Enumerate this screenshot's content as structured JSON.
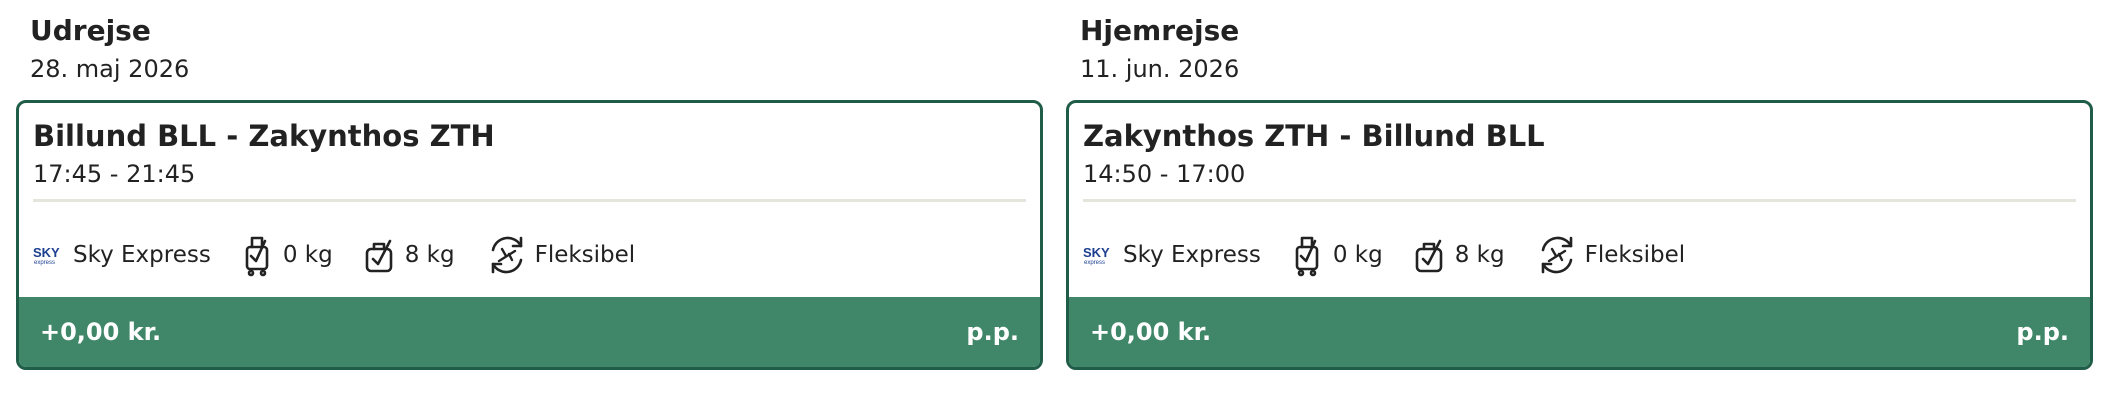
{
  "legs": [
    {
      "title": "Udrejse",
      "date": "28. maj 2026",
      "route": "Billund BLL - Zakynthos ZTH",
      "times": "17:45 - 21:45",
      "airline": {
        "logo_text": "SKY",
        "logo_subtext": "express",
        "name": "Sky Express"
      },
      "carry_on": "0 kg",
      "personal_bag": "8 kg",
      "ticket_type": "Fleksibel",
      "price": "+0,00 kr.",
      "price_unit": "p.p."
    },
    {
      "title": "Hjemrejse",
      "date": "11. jun. 2026",
      "route": "Zakynthos ZTH - Billund BLL",
      "times": "14:50 - 17:00",
      "airline": {
        "logo_text": "SKY",
        "logo_subtext": "express",
        "name": "Sky Express"
      },
      "carry_on": "0 kg",
      "personal_bag": "8 kg",
      "ticket_type": "Fleksibel",
      "price": "+0,00 kr.",
      "price_unit": "p.p."
    }
  ],
  "colors": {
    "card_border": "#1f5d48",
    "price_bar": "#3f8768",
    "divider": "#e3e6dd",
    "text": "#222222",
    "airline_logo": "#1d3f8f"
  },
  "icons": {
    "airline": "sky-express-logo",
    "carry_on": "trolley-bag-check-icon",
    "personal_bag": "bag-check-icon",
    "ticket_type": "flexible-flight-icon"
  }
}
